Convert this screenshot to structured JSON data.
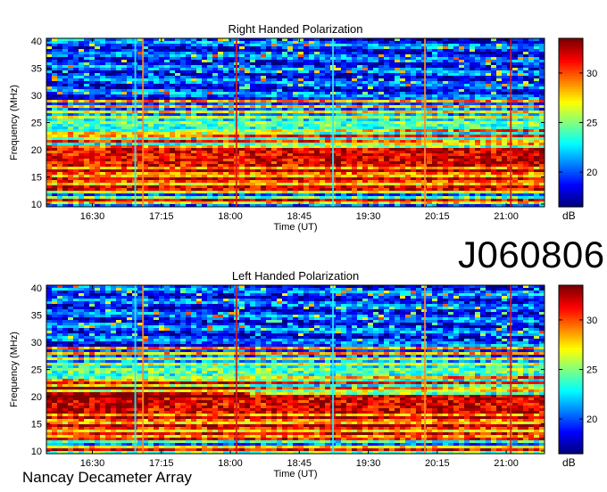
{
  "observation_id": "J060806",
  "footer": "Nancay Decameter Array",
  "colorbar": {
    "unit": "dB",
    "ticks": [
      20,
      25,
      30
    ],
    "range": [
      16.5,
      33.5
    ],
    "colormap": "jet"
  },
  "chart_data": [
    {
      "type": "heatmap",
      "title": "Right Handed Polarization",
      "xlabel": "Time (UT)",
      "ylabel": "Frequency (MHz)",
      "x_ticks": [
        "16:30",
        "17:15",
        "18:00",
        "18:45",
        "19:30",
        "20:15",
        "21:00"
      ],
      "y_ticks": [
        10,
        15,
        20,
        25,
        30,
        35,
        40
      ],
      "ylim": [
        9.5,
        40.5
      ],
      "xlim": [
        "16:00",
        "21:25"
      ],
      "vertical_artifacts_ut": [
        "16:58",
        "17:03",
        "18:04",
        "19:07",
        "20:07",
        "21:03"
      ],
      "colorbar_unit": "dB",
      "colorbar_ticks": [
        20,
        25,
        30
      ]
    },
    {
      "type": "heatmap",
      "title": "Left Handed Polarization",
      "xlabel": "Time (UT)",
      "ylabel": "Frequency (MHz)",
      "x_ticks": [
        "16:30",
        "17:15",
        "18:00",
        "18:45",
        "19:30",
        "20:15",
        "21:00"
      ],
      "y_ticks": [
        10,
        15,
        20,
        25,
        30,
        35,
        40
      ],
      "ylim": [
        9.5,
        40.5
      ],
      "xlim": [
        "16:00",
        "21:25"
      ],
      "vertical_artifacts_ut": [
        "16:58",
        "17:03",
        "18:04",
        "19:07",
        "20:07",
        "21:03"
      ],
      "colorbar_unit": "dB",
      "colorbar_ticks": [
        20,
        25,
        30
      ]
    }
  ]
}
